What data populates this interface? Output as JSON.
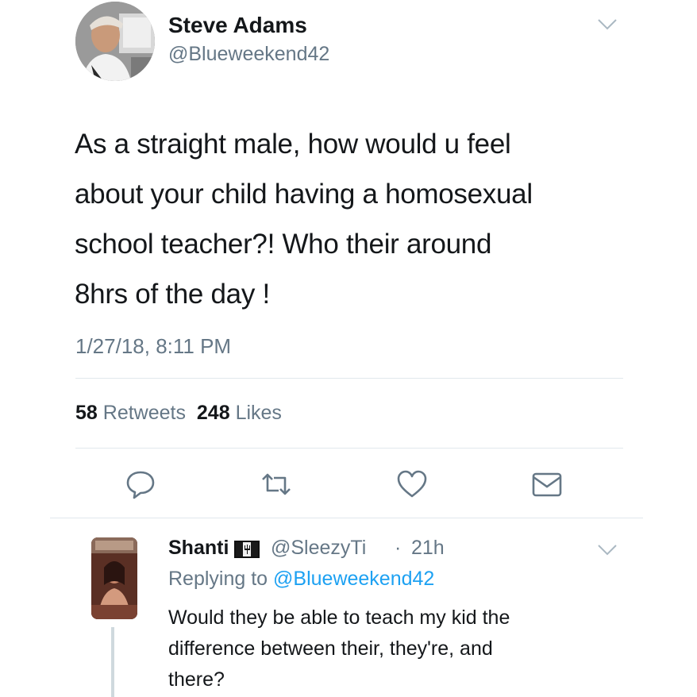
{
  "tweet": {
    "author_name": "Steve Adams",
    "author_handle": "@Blueweekend42",
    "text": "As a straight male, how would u feel\nabout your child having a homosexual\nschool teacher?! Who their around\n8hrs of the day !",
    "timestamp": "1/27/18, 8:11 PM",
    "retweets_count": "58",
    "retweets_label": "Retweets",
    "likes_count": "248",
    "likes_label": "Likes"
  },
  "actions": {
    "reply_icon": "reply-icon",
    "retweet_icon": "retweet-icon",
    "like_icon": "heart-icon",
    "share_icon": "envelope-icon"
  },
  "reply": {
    "author_name": "Shanti",
    "flag_icon": "barbados-flag-icon",
    "author_handle": "@SleezyTi",
    "separator": "·",
    "time": "21h",
    "replying_prefix": "Replying to",
    "replying_to": "@Blueweekend42",
    "text": "Would they be able to teach my kid the\ndifference between their, they're, and\nthere?"
  },
  "colors": {
    "text": "#14171a",
    "secondary": "#657786",
    "link": "#1da1f2",
    "divider": "#e1e8ed"
  }
}
